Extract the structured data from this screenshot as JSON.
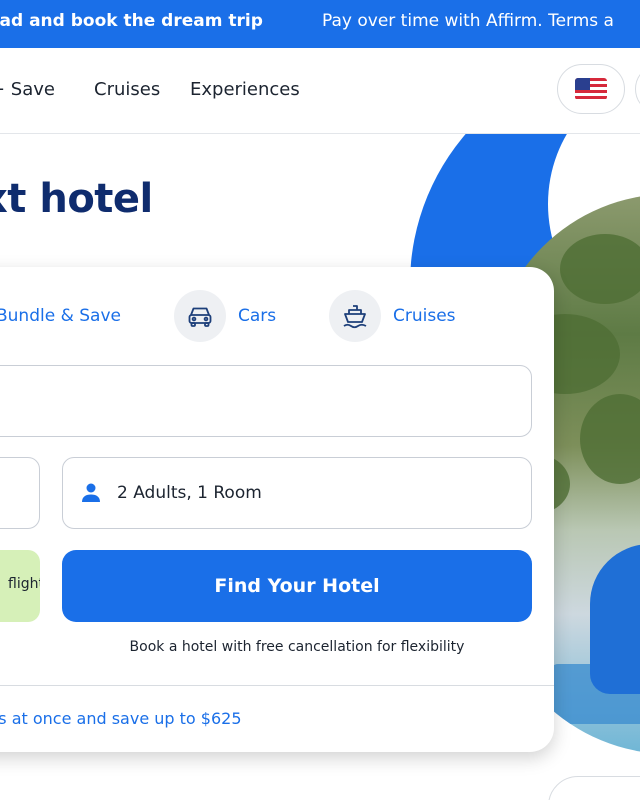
{
  "promo_bar": {
    "message_left": "ead and book the dream trip",
    "message_right": "Pay over time with Affirm. Terms a"
  },
  "nav": {
    "links": [
      {
        "label": "+ Save"
      },
      {
        "label": "Cruises"
      },
      {
        "label": "Experiences"
      }
    ],
    "flag_icon": "us-flag-icon"
  },
  "hero": {
    "heading": "xt hotel"
  },
  "search_card": {
    "tabs": [
      {
        "label": "Bundle & Save",
        "icon": "bundle-icon"
      },
      {
        "label": "Cars",
        "icon": "car-icon"
      },
      {
        "label": "Cruises",
        "icon": "ship-icon"
      }
    ],
    "guests_value": "2 Adults, 1 Room",
    "add_flight_label": "flight",
    "find_button_label": "Find Your Hotel",
    "cancellation_note": "Book a hotel with free cancellation for flexibility",
    "savings_link": "els at once and save up to $625"
  },
  "colors": {
    "brand_blue": "#1a6fe8",
    "heading_navy": "#0f2c6e",
    "add_flight_green": "#d6f0b8"
  }
}
